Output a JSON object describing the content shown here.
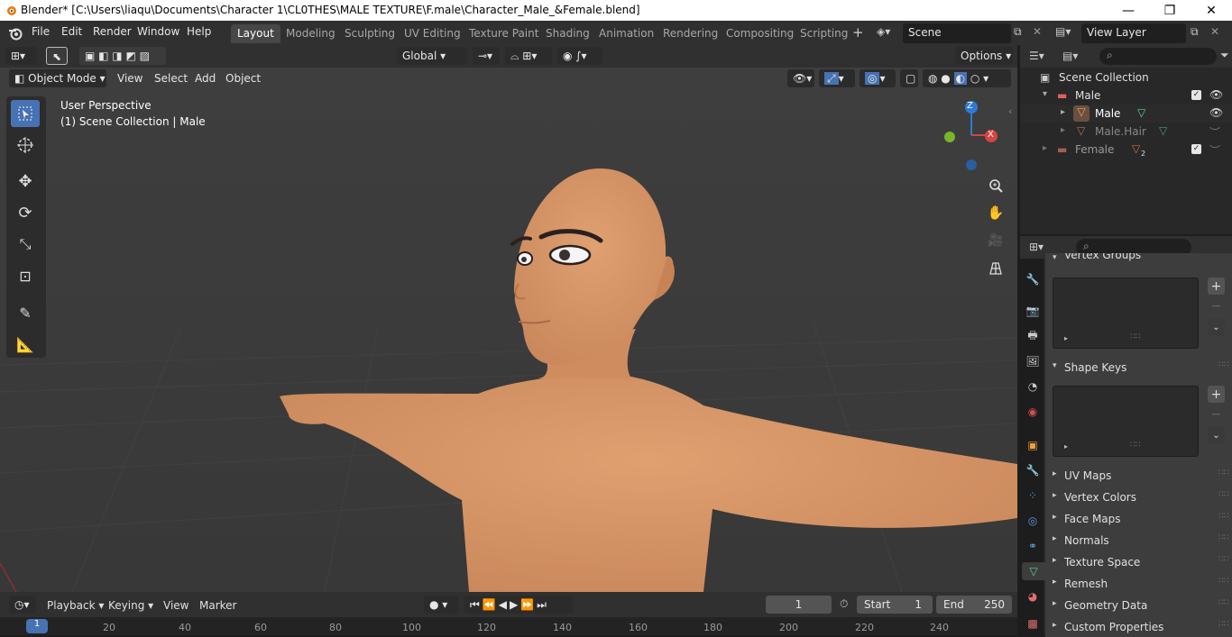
{
  "window": {
    "title": "Blender* [C:\\Users\\liaqu\\Documents\\Character 1\\CL0THES\\MALE TEXTURE\\F.male\\Character_Male_&Female.blend]",
    "minimize": "—",
    "maximize": "❐",
    "close": "✕"
  },
  "menu": [
    "File",
    "Edit",
    "Render",
    "Window",
    "Help"
  ],
  "workspaces": [
    "Layout",
    "Modeling",
    "Sculpting",
    "UV Editing",
    "Texture Paint",
    "Shading",
    "Animation",
    "Rendering",
    "Compositing",
    "Scripting"
  ],
  "active_workspace": "Layout",
  "scene": {
    "label": "Scene",
    "view_layer": "View Layer"
  },
  "tool_header": {
    "orientation": "Global",
    "options": "Options"
  },
  "viewport_header": {
    "mode": "Object Mode",
    "menus": [
      "View",
      "Select",
      "Add",
      "Object"
    ]
  },
  "viewport": {
    "perspective": "User Perspective",
    "collection": "(1) Scene Collection | Male",
    "gizmo_z": "Z",
    "gizmo_x": "X"
  },
  "outliner": {
    "root": "Scene Collection",
    "items": [
      {
        "label": "Male",
        "kind": "collection"
      },
      {
        "label": "Male",
        "kind": "mesh"
      },
      {
        "label": "Male.Hair",
        "kind": "mesh"
      },
      {
        "label": "Female",
        "kind": "collection",
        "badge": "2"
      }
    ]
  },
  "properties": {
    "sections": {
      "vertex_groups": "Vertex Groups",
      "shape_keys": "Shape Keys",
      "collapsed": [
        "UV Maps",
        "Vertex Colors",
        "Face Maps",
        "Normals",
        "Texture Space",
        "Remesh",
        "Geometry Data",
        "Custom Properties"
      ]
    }
  },
  "timeline": {
    "menus": [
      "Playback",
      "Keying",
      "View",
      "Marker"
    ],
    "current_frame": "1",
    "start_label": "Start",
    "start": "1",
    "end_label": "End",
    "end": "250",
    "ruler": [
      "1",
      "20",
      "40",
      "60",
      "80",
      "100",
      "120",
      "140",
      "160",
      "180",
      "200",
      "220",
      "240"
    ]
  },
  "colors": {
    "accent": "#4772b3",
    "skin": "#d99869",
    "panel": "#282828",
    "viewport": "#3d3d3d"
  }
}
